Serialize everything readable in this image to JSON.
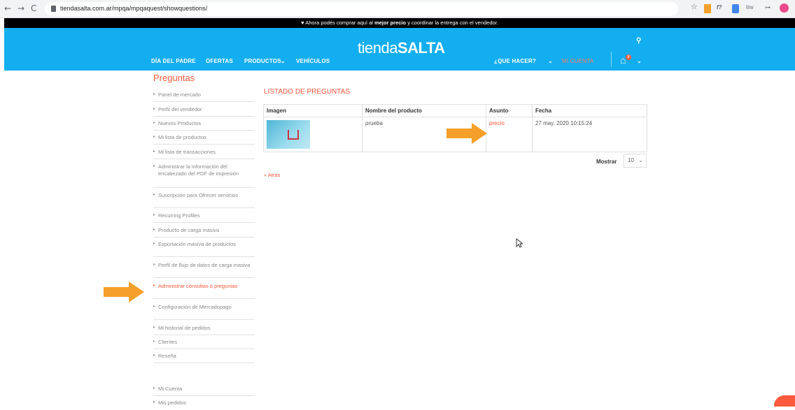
{
  "browser": {
    "url": "tiendasalta.com.ar/mpqa/mpqaquest/showquestions/",
    "extensions": [
      "f?",
      "Inv"
    ]
  },
  "promo": {
    "prefix": "Ahora podés comprar aquí al",
    "highlight": "mejor precio",
    "suffix": "y coordinar la entrega con el vendedor."
  },
  "header": {
    "logo_thin": "tienda",
    "logo_bold": "SALTA",
    "nav": [
      "DÍA DEL PADRE",
      "OFERTAS",
      "PRODUCTOS",
      "VEHÍCULOS"
    ],
    "que_hacer": "¿QUE HACER?",
    "mi_cuenta": "MI CUENTA",
    "cart_count": "0"
  },
  "sidebar": {
    "title": "Preguntas",
    "items": [
      "Panel de mercado",
      "Perfil del vendedor",
      "Nuevos Productos",
      "Mi lista de productos",
      "Mi lista de transacciones",
      "Administrar la información del encabezado del PDF de impresión",
      "Suscripción para Ofrecer servicios",
      "Recurring Profiles",
      "Producto de carga masiva",
      "Exportación masiva de productos",
      "Perfil de flujo de datos de carga masiva",
      "Administrar consultas o preguntas",
      "Configuración de Mercadopago",
      "Mi historial de pedidos",
      "Clientes",
      "Reseña"
    ],
    "bottom_items": [
      "Mi Cuenta",
      "Mis pedidos"
    ]
  },
  "main": {
    "section_title": "LISTADO DE PREGUNTAS",
    "columns": [
      "Imagen",
      "Nombre del producto",
      "Asunto",
      "Fecha"
    ],
    "rows": [
      {
        "product": "prueba",
        "subject": "precio",
        "date": "27 may. 2020 10:15:24"
      }
    ],
    "mostrar_label": "Mostrar",
    "page_size": "10",
    "back_label": "« Atrás"
  },
  "colors": {
    "accent": "#ff5a3d",
    "header": "#13aef0",
    "arrow": "#f5a02a"
  }
}
